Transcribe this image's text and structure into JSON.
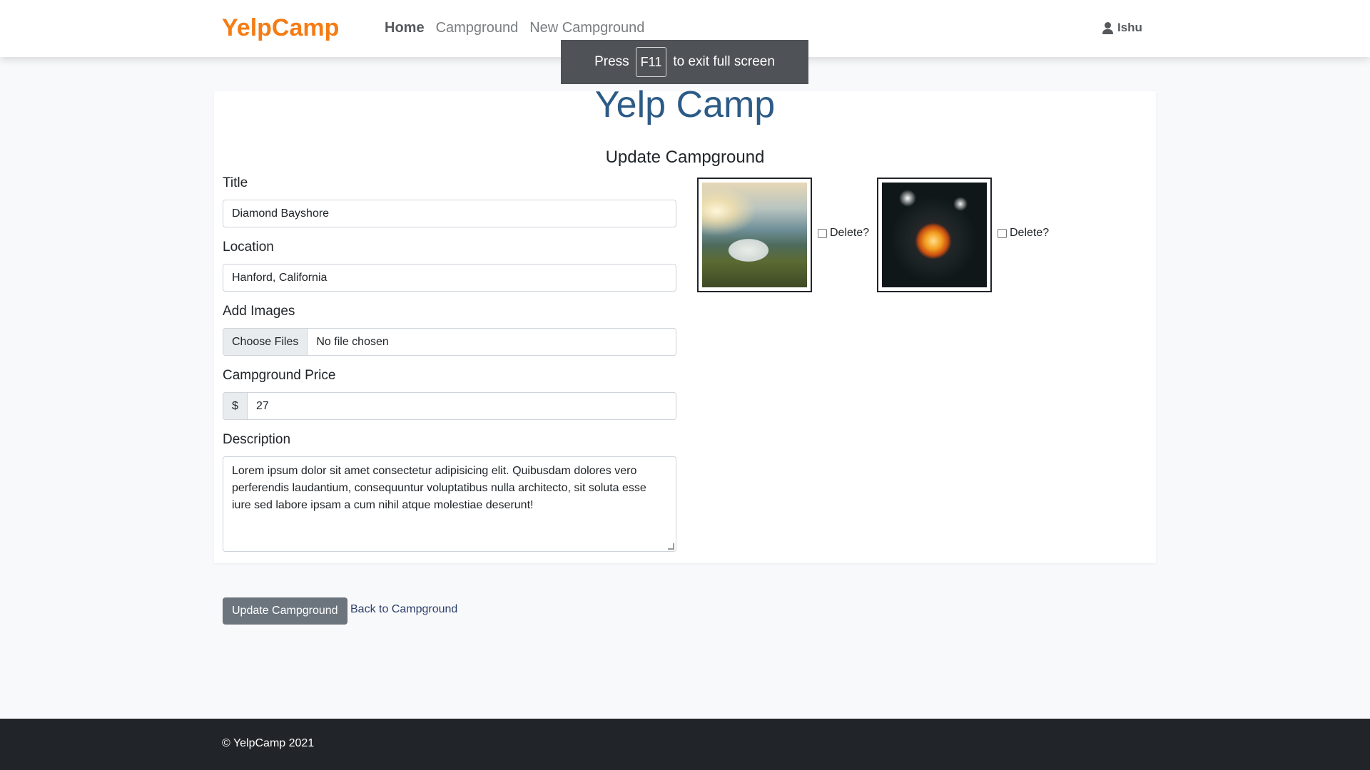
{
  "colors": {
    "brand": "#f57c15",
    "title": "#2d5b87",
    "button": "#6c757d",
    "footer": "#212529"
  },
  "navbar": {
    "brand": "YelpCamp",
    "links": [
      "Home",
      "Campground",
      "New Campground"
    ],
    "active_link": "Home",
    "user": "Ishu",
    "user_icon": "user-icon"
  },
  "fullscreen_notice": {
    "prefix": "Press",
    "key": "F11",
    "suffix": "to exit full screen"
  },
  "page": {
    "title": "Yelp Camp",
    "heading": "Update Campground"
  },
  "form": {
    "title_label": "Title",
    "title_value": "Diamond Bayshore",
    "location_label": "Location",
    "location_value": "Hanford, California",
    "images_label": "Add Images",
    "file_button": "Choose Files",
    "file_status": "No file chosen",
    "price_label": "Campground Price",
    "price_prefix": "$",
    "price_value": "27",
    "description_label": "Description",
    "description_value": "Lorem ipsum dolor sit amet consectetur adipisicing elit. Quibusdam dolores vero perferendis laudantium, consequuntur voluptatibus nulla architecto, sit soluta esse iure sed labore ipsam a cum nihil atque molestiae deserunt!"
  },
  "images": [
    {
      "delete_label": "Delete?",
      "checked": false
    },
    {
      "delete_label": "Delete?",
      "checked": false
    }
  ],
  "actions": {
    "submit": "Update Campground",
    "back": "Back to Campground"
  },
  "footer": {
    "text": "© YelpCamp 2021"
  }
}
